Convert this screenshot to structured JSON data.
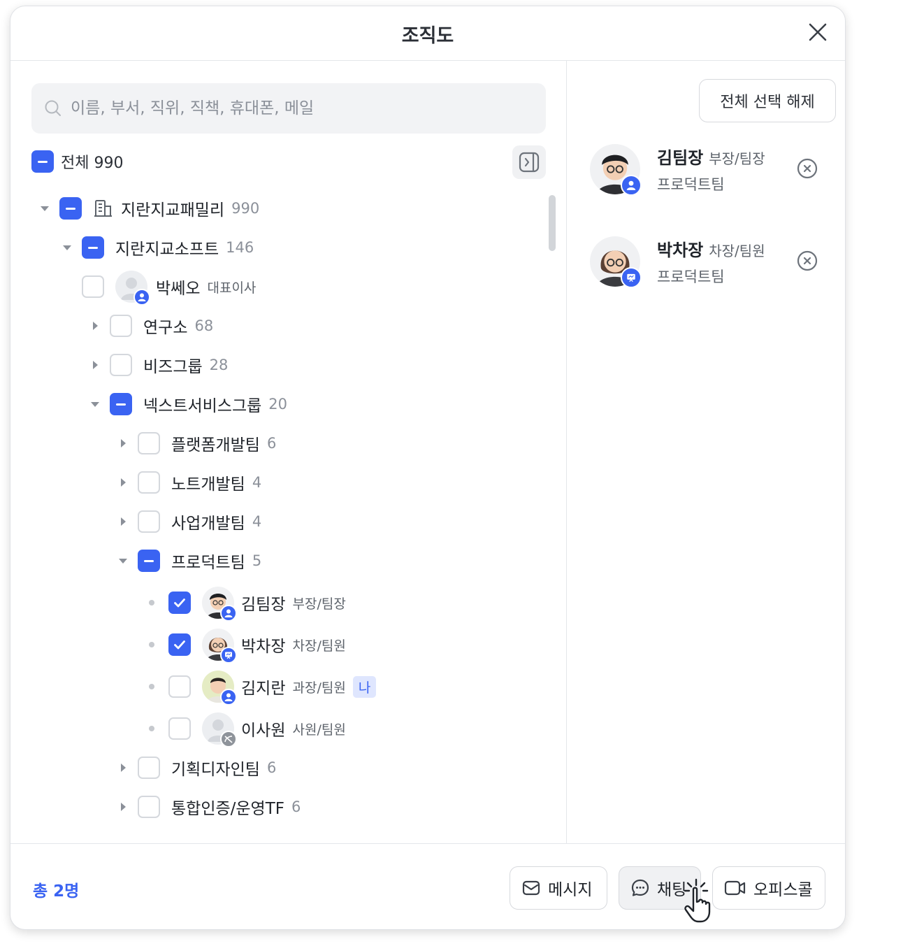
{
  "dialog": {
    "title": "조직도"
  },
  "search": {
    "placeholder": "이름, 부서, 직위, 직책, 휴대폰, 메일",
    "value": ""
  },
  "all": {
    "label": "전체",
    "count": "990"
  },
  "tree": [
    {
      "name": "지란지교패밀리",
      "count": "990",
      "expanded": true,
      "state": "partial"
    },
    {
      "name": "지란지교소프트",
      "count": "146",
      "expanded": true,
      "state": "partial"
    },
    {
      "name": "박쎄오",
      "rank": "대표이사",
      "state": "off"
    },
    {
      "name": "연구소",
      "count": "68",
      "expanded": false,
      "state": "off"
    },
    {
      "name": "비즈그룹",
      "count": "28",
      "expanded": false,
      "state": "off"
    },
    {
      "name": "넥스트서비스그룹",
      "count": "20",
      "expanded": true,
      "state": "partial"
    },
    {
      "name": "플랫폼개발팀",
      "count": "6",
      "expanded": false,
      "state": "off"
    },
    {
      "name": "노트개발팀",
      "count": "4",
      "expanded": false,
      "state": "off"
    },
    {
      "name": "사업개발팀",
      "count": "4",
      "expanded": false,
      "state": "off"
    },
    {
      "name": "프로덕트팀",
      "count": "5",
      "expanded": true,
      "state": "partial"
    },
    {
      "name": "김팀장",
      "rank": "부장/팀장",
      "state": "on"
    },
    {
      "name": "박차장",
      "rank": "차장/팀원",
      "state": "on"
    },
    {
      "name": "김지란",
      "rank": "과장/팀원",
      "badge": "나",
      "state": "off"
    },
    {
      "name": "이사원",
      "rank": "사원/팀원",
      "state": "off"
    },
    {
      "name": "기획디자인팀",
      "count": "6",
      "expanded": false,
      "state": "off"
    },
    {
      "name": "통합인증/운영TF",
      "count": "6",
      "expanded": false,
      "state": "off"
    }
  ],
  "selected": {
    "clear_label": "전체 선택 해제",
    "items": [
      {
        "name": "김팀장",
        "rank": "부장/팀장",
        "team": "프로덕트팀"
      },
      {
        "name": "박차장",
        "rank": "차장/팀원",
        "team": "프로덕트팀"
      }
    ]
  },
  "footer": {
    "total": "총 2명",
    "message_label": "메시지",
    "chat_label": "채팅",
    "officecall_label": "오피스콜"
  },
  "colors": {
    "accent": "#3a63f2",
    "border": "#d7d9dd",
    "muted": "#8b9099"
  },
  "icons": [
    "close-icon",
    "search-icon",
    "panel-collapse-icon",
    "building-icon",
    "remove-icon",
    "message-icon",
    "chat-icon",
    "video-icon",
    "pointer-cursor-icon"
  ]
}
